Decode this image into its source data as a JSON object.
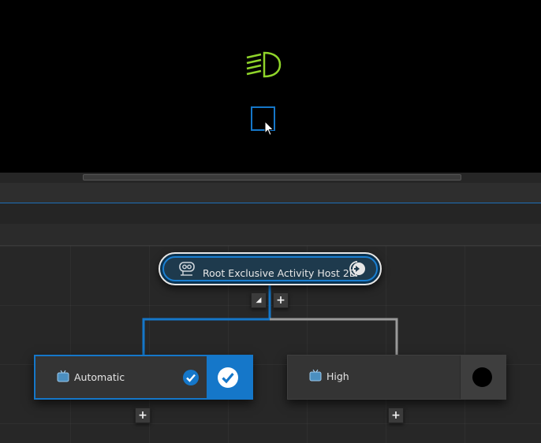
{
  "viewport": {
    "headlight_icon": "headlight-icon",
    "cursor_icon": "arrow-cursor-icon"
  },
  "graph": {
    "root": {
      "label": "Root Exclusive Activity Host 2D",
      "icon": "activity-host-icon",
      "end_icon": "exit-arrow-icon"
    },
    "root_controls": {
      "collapse_label": "◢",
      "add_label": "+"
    },
    "states": [
      {
        "label": "Automatic",
        "icon": "state-icon",
        "active": true,
        "check_icon": "check-circle-icon",
        "add_label": "+"
      },
      {
        "label": "High",
        "icon": "state-icon",
        "active": false,
        "indicator_icon": "inactive-dot-icon",
        "add_label": "+"
      }
    ]
  },
  "colors": {
    "accent": "#1577c9",
    "headlight": "#8fd42a",
    "connector_inactive": "#9a9a9a"
  }
}
